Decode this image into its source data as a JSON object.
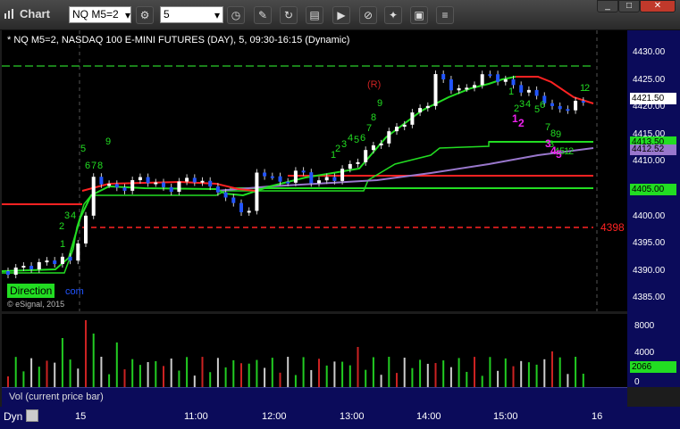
{
  "app": {
    "title": "Chart"
  },
  "toolbar": {
    "symbol_value": "NQ M5=2",
    "interval_value": "5",
    "icons": [
      "symbol-dropdown-icon",
      "symbol-settings-icon",
      "interval-dropdown-icon",
      "clock-icon",
      "pencil-icon",
      "refresh-icon",
      "print-icon",
      "play-icon",
      "no-entry-icon",
      "pin-icon",
      "save-icon",
      "menu-icon"
    ]
  },
  "chart": {
    "header": "* NQ M5=2, NASDAQ 100 E-MINI FUTURES (DAY), 5, 09:30-16:15 (Dynamic)",
    "copyright": "© eSignal, 2015",
    "direction_label": "Direction",
    "direction_suffix": "com",
    "price_levels": [
      "4430.00",
      "4425.00",
      "4420.00",
      "4415.00",
      "4410.00",
      "4405.00",
      "4400.00",
      "4395.00",
      "4390.00",
      "4385.00"
    ],
    "badges": [
      {
        "text": "4421.50",
        "color": "#ffffff"
      },
      {
        "text": "4413.50",
        "color": "#22dd22"
      },
      {
        "text": "4412.52",
        "color": "#9977cc"
      },
      {
        "text": "4405.00",
        "color": "#22dd22"
      }
    ],
    "red_dashed_level": "4398",
    "r_label": "(R)",
    "count_labels": [
      "1",
      "2",
      "3",
      "4",
      "5",
      "6",
      "7",
      "8",
      "9",
      "1",
      "2",
      "3",
      "4",
      "5",
      "6",
      "7",
      "8",
      "9",
      "1",
      "2",
      "3",
      "4",
      "5",
      "6",
      "7",
      "8",
      "9",
      "1",
      "2",
      "3",
      "4",
      "5",
      "1",
      "2"
    ],
    "magenta_labels": [
      "1",
      "2",
      "3",
      "4",
      "5"
    ],
    "colors": {
      "up": "#ffffff",
      "down": "#2255ff",
      "green": "#22dd22",
      "red": "#ff2222",
      "purple": "#9977cc",
      "axis_bg": "#0b0b5a"
    }
  },
  "volume": {
    "label": "Vol (current price bar)",
    "levels": [
      "8000",
      "4000",
      "0"
    ],
    "badge": "2066"
  },
  "time_axis": {
    "mode": "Dyn",
    "labels": [
      "15",
      "11:00",
      "12:00",
      "13:00",
      "14:00",
      "15:00",
      "16"
    ]
  }
}
